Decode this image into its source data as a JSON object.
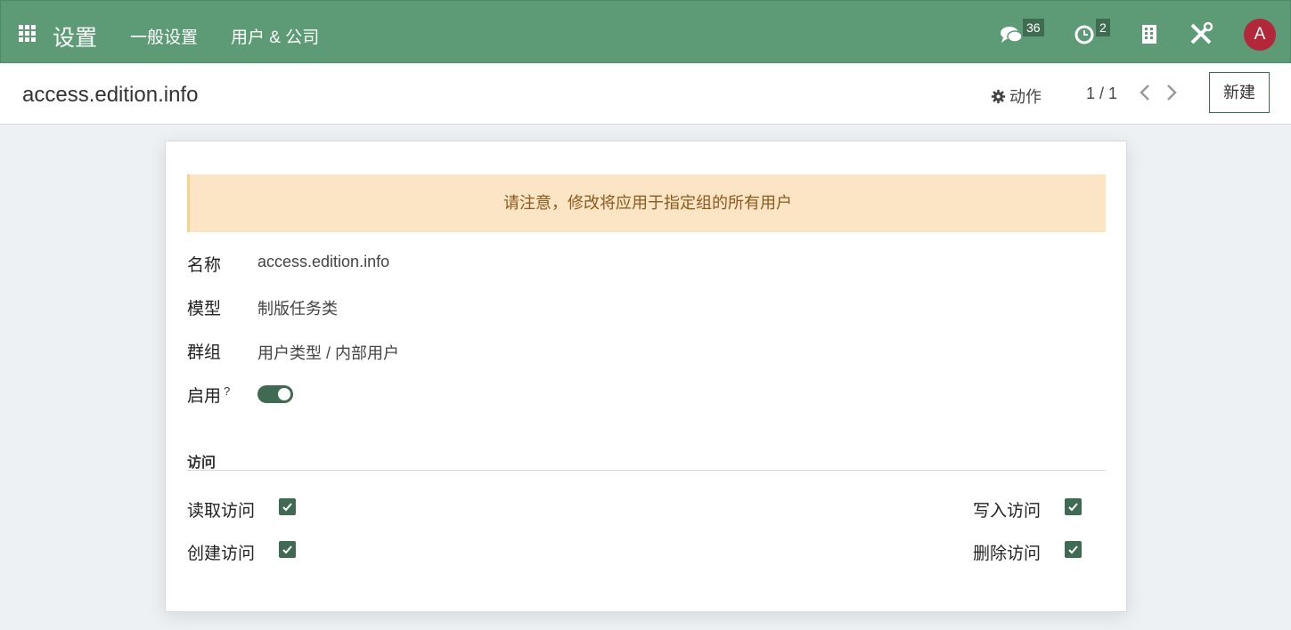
{
  "navbar": {
    "app_title": "设置",
    "menu": [
      "一般设置",
      "用户 & 公司"
    ],
    "messages_count": "36",
    "activities_count": "2",
    "avatar_letter": "A",
    "bg_color": "#5d9a76"
  },
  "control_panel": {
    "breadcrumb": "access.edition.info",
    "action_label": "动作",
    "pager": "1 / 1",
    "new_button": "新建"
  },
  "form": {
    "alert": "请注意，修改将应用于指定组的所有用户",
    "fields": {
      "name_label": "名称",
      "name_value": "access.edition.info",
      "model_label": "模型",
      "model_value": "制版任务类",
      "group_label": "群组",
      "group_value": "用户类型 / 内部用户",
      "active_label": "启用",
      "active_help": "?",
      "active_value": true
    },
    "access_section": {
      "title": "访问",
      "read_label": "读取访问",
      "read_checked": true,
      "write_label": "写入访问",
      "write_checked": true,
      "create_label": "创建访问",
      "create_checked": true,
      "delete_label": "删除访问",
      "delete_checked": true
    }
  },
  "colors": {
    "primary": "#3f6b52",
    "alert_bg": "#fbe5c4",
    "alert_text": "#8c5a1f",
    "avatar_bg": "#b3273a"
  }
}
